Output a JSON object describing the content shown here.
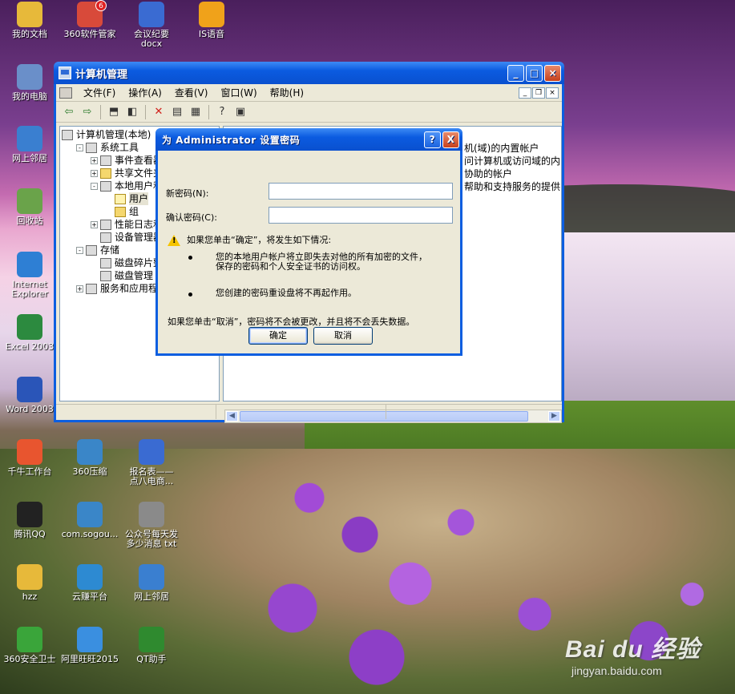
{
  "desktop_icons": [
    {
      "id": "my-documents",
      "label": "我的文档",
      "icon": "folder-docs-icon",
      "color": "#e7b93a"
    },
    {
      "id": "360-software",
      "label": "360软件管家",
      "icon": "app-grid-icon",
      "color": "#d84a3a"
    },
    {
      "id": "meeting-minutes",
      "label": "会议纪要\ndocx",
      "icon": "word-doc-icon",
      "color": "#3a6bd2"
    },
    {
      "id": "is-voice",
      "label": "IS语音",
      "icon": "mascot-icon",
      "color": "#f0a21a"
    },
    {
      "id": "my-computer",
      "label": "我的电脑",
      "icon": "computer-icon",
      "color": "#6a8fc9"
    },
    {
      "id": "network-neighborhood-left",
      "label": "网上邻居",
      "icon": "network-icon",
      "color": "#3a7fd0"
    },
    {
      "id": "recycle-bin",
      "label": "回收站",
      "icon": "recycle-icon",
      "color": "#6aa34a"
    },
    {
      "id": "internet-explorer",
      "label": "Internet\nExplorer",
      "icon": "ie-icon",
      "color": "#2e7fd4"
    },
    {
      "id": "excel-2003",
      "label": "Excel 2003",
      "icon": "excel-icon",
      "color": "#2c8a3f"
    },
    {
      "id": "word-2003",
      "label": "Word 2003",
      "icon": "word-icon",
      "color": "#2a55b8"
    },
    {
      "id": "qianniu",
      "label": "千牛工作台",
      "icon": "qianniu-icon",
      "color": "#e8552f"
    },
    {
      "id": "360-zip",
      "label": "360压缩",
      "icon": "archive-icon",
      "color": "#3a86c8"
    },
    {
      "id": "signup-table",
      "label": "报名表——\n点八电商...",
      "icon": "doc-icon",
      "color": "#3a6bd2"
    },
    {
      "id": "tencent-qq",
      "label": "腾讯QQ",
      "icon": "qq-icon",
      "color": "#222222"
    },
    {
      "id": "com-sogou",
      "label": "com.sogou...",
      "icon": "archive-icon",
      "color": "#3a86c8"
    },
    {
      "id": "wechat-txt",
      "label": "公众号每天发\n多少消息 txt",
      "icon": "txt-icon",
      "color": "#8a8a8a"
    },
    {
      "id": "hzz",
      "label": "hzz",
      "icon": "folder-icon",
      "color": "#e7b93a"
    },
    {
      "id": "yunzhuan",
      "label": "云赚平台",
      "icon": "cloud-icon",
      "color": "#2d8ad2"
    },
    {
      "id": "network-neighborhood-right",
      "label": "网上邻居",
      "icon": "network-icon",
      "color": "#3a7fd0"
    },
    {
      "id": "360-security",
      "label": "360安全卫士",
      "icon": "shield-plus-icon",
      "color": "#3aa53a"
    },
    {
      "id": "aliwangwang",
      "label": "阿里旺旺2015",
      "icon": "wangwang-icon",
      "color": "#3a8fe0"
    },
    {
      "id": "qt-helper",
      "label": "QT助手",
      "icon": "qt-icon",
      "color": "#2f8a2f"
    }
  ],
  "badge_360": "6",
  "cm_window": {
    "title": "计算机管理",
    "menus": [
      "文件(F)",
      "操作(A)",
      "查看(V)",
      "窗口(W)",
      "帮助(H)"
    ],
    "tree": [
      {
        "label": "计算机管理(本地)",
        "level": 0,
        "exp": "",
        "icon": "computer"
      },
      {
        "label": "系统工具",
        "level": 1,
        "exp": "-",
        "icon": "tools"
      },
      {
        "label": "事件查看器",
        "level": 2,
        "exp": "+",
        "icon": "event"
      },
      {
        "label": "共享文件夹",
        "level": 2,
        "exp": "+",
        "icon": "folder"
      },
      {
        "label": "本地用户和组",
        "level": 2,
        "exp": "-",
        "icon": "users"
      },
      {
        "label": "用户",
        "level": 3,
        "exp": "",
        "icon": "folder",
        "selected": true
      },
      {
        "label": "组",
        "level": 3,
        "exp": "",
        "icon": "folder"
      },
      {
        "label": "性能日志和警报",
        "level": 2,
        "exp": "+",
        "icon": "perf"
      },
      {
        "label": "设备管理器",
        "level": 2,
        "exp": "",
        "icon": "device"
      },
      {
        "label": "存储",
        "level": 1,
        "exp": "-",
        "icon": "storage"
      },
      {
        "label": "磁盘碎片整理程序",
        "level": 2,
        "exp": "",
        "icon": "defrag"
      },
      {
        "label": "磁盘管理",
        "level": 2,
        "exp": "",
        "icon": "disk"
      },
      {
        "label": "服务和应用程序",
        "level": 1,
        "exp": "+",
        "icon": "services"
      }
    ],
    "right_rows": [
      "机(域)的内置帐户",
      "问计算机或访问域的内",
      "协助的帐户",
      "帮助和支持服务的提供"
    ]
  },
  "dialog": {
    "title": "为 Administrator 设置密码",
    "new_password_label": "新密码(N):",
    "confirm_password_label": "确认密码(C):",
    "new_password_value": "",
    "confirm_password_value": "",
    "warning_heading": "如果您单击“确定”，将发生如下情况:",
    "bullet1_line1": "您的本地用户帐户将立即失去对他的所有加密的文件，",
    "bullet1_line2": "保存的密码和个人安全证书的访问权。",
    "bullet2": "您创建的密码重设盘将不再起作用。",
    "cancel_note": "如果您单击“取消”，密码将不会被更改，并且将不会丢失数据。",
    "ok_label": "确定",
    "cancel_label": "取消",
    "help_label": "?",
    "close_label": "X"
  },
  "watermark": {
    "main": "Bai du 经验",
    "sub": "jingyan.baidu.com"
  }
}
